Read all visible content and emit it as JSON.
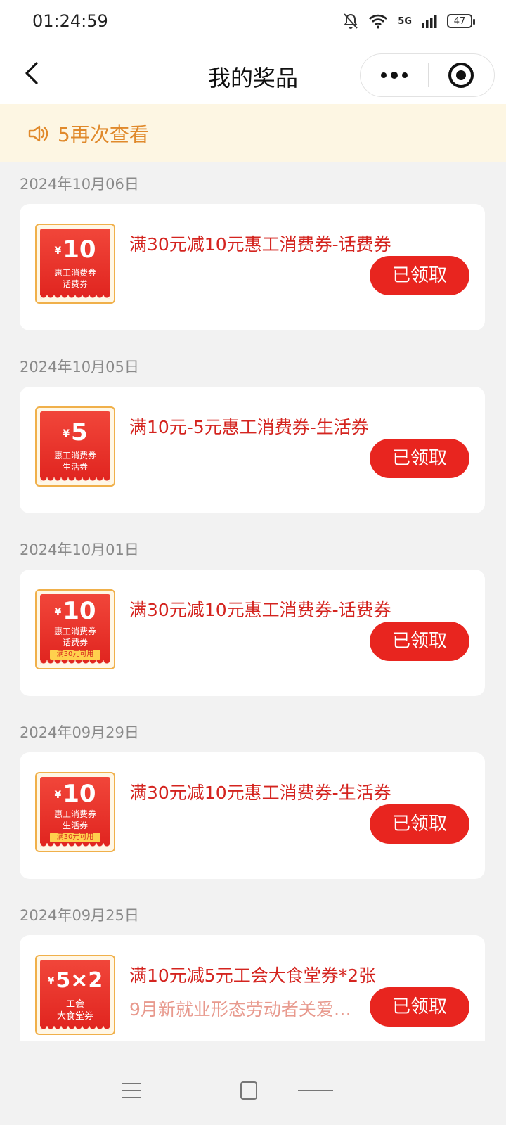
{
  "status_bar": {
    "time": "01:24:59",
    "signal_label": "5G",
    "battery": "47"
  },
  "nav": {
    "title": "我的奖品"
  },
  "notice": {
    "text": "5再次查看"
  },
  "prizes": [
    {
      "date": "2024年10月06日",
      "title": "满30元减10元惠工消费券-话费券",
      "subtitle": "",
      "button": "已领取",
      "coupon": {
        "currency": "¥",
        "value": "10",
        "line1": "惠工消费券",
        "line2": "话费券",
        "cond": ""
      }
    },
    {
      "date": "2024年10月05日",
      "title": "满10元-5元惠工消费券-生活券",
      "subtitle": "",
      "button": "已领取",
      "coupon": {
        "currency": "¥",
        "value": "5",
        "line1": "惠工消费券",
        "line2": "生活券",
        "cond": ""
      }
    },
    {
      "date": "2024年10月01日",
      "title": "满30元减10元惠工消费券-话费券",
      "subtitle": "",
      "button": "已领取",
      "coupon": {
        "currency": "¥",
        "value": "10",
        "line1": "惠工消费券",
        "line2": "话费券",
        "cond": "满30元可用"
      }
    },
    {
      "date": "2024年09月29日",
      "title": "满30元减10元惠工消费券-生活券",
      "subtitle": "",
      "button": "已领取",
      "coupon": {
        "currency": "¥",
        "value": "10",
        "line1": "惠工消费券",
        "line2": "生活券",
        "cond": "满30元可用"
      }
    },
    {
      "date": "2024年09月25日",
      "title": "满10元减5元工会大食堂券*2张",
      "subtitle": "9月新就业形态劳动者关爱…",
      "button": "已领取",
      "coupon": {
        "currency": "¥",
        "value": "5×2",
        "line1": "工会",
        "line2": "大食堂券",
        "cond": ""
      }
    }
  ]
}
